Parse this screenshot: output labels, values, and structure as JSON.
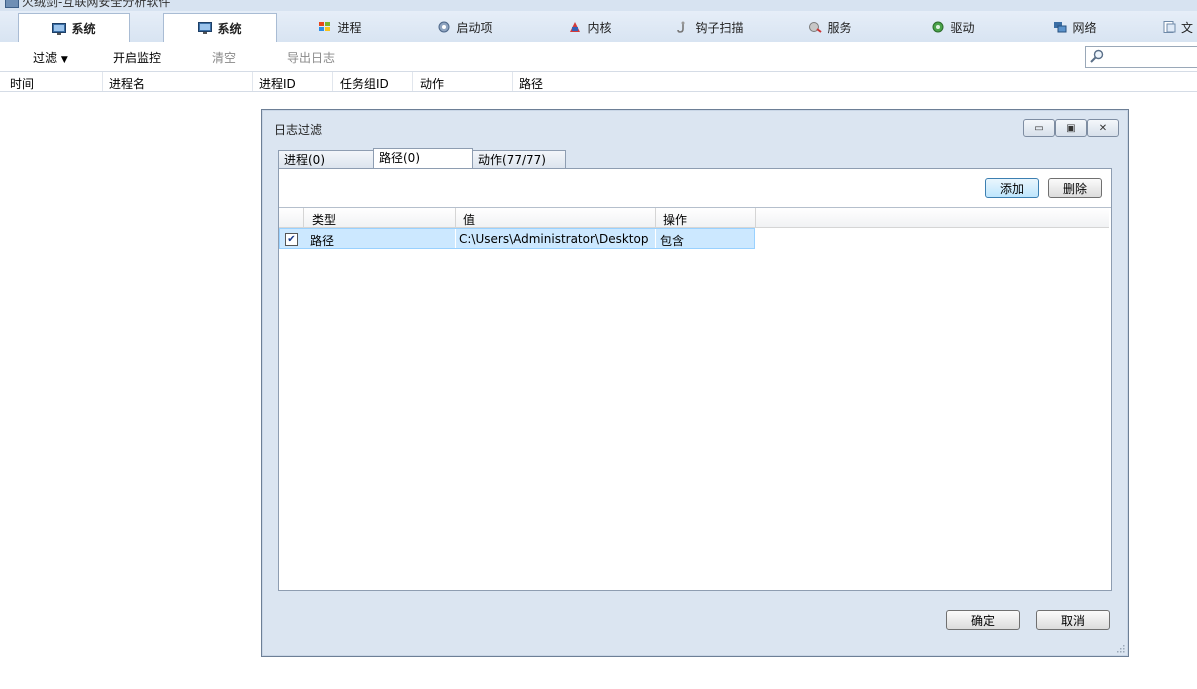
{
  "window": {
    "title": "火绒剑-互联网安全分析软件"
  },
  "tabs": [
    {
      "label": "系统",
      "icon": "monitor-icon"
    },
    {
      "label": "系统",
      "icon": "monitor-icon"
    },
    {
      "label": "进程",
      "icon": "windows-logo-icon"
    },
    {
      "label": "启动项",
      "icon": "startup-gear-icon"
    },
    {
      "label": "内核",
      "icon": "kernel-icon"
    },
    {
      "label": "钩子扫描",
      "icon": "hook-icon"
    },
    {
      "label": "服务",
      "icon": "service-icon"
    },
    {
      "label": "驱动",
      "icon": "driver-icon"
    },
    {
      "label": "网络",
      "icon": "network-icon"
    },
    {
      "label": "文",
      "icon": "file-icon"
    }
  ],
  "toolbar": {
    "filter": "过滤",
    "start_monitor": "开启监控",
    "clear": "清空",
    "export_log": "导出日志",
    "search_placeholder": ""
  },
  "columns": [
    "时间",
    "进程名",
    "进程ID",
    "任务组ID",
    "动作",
    "路径"
  ],
  "dialog": {
    "title": "日志过滤",
    "tabs": [
      "进程(0)",
      "路径(0)",
      "动作(77/77)"
    ],
    "add_button": "添加",
    "delete_button": "删除",
    "grid_headers": [
      "类型",
      "值",
      "操作"
    ],
    "rows": [
      {
        "checked": true,
        "type": "路径",
        "value": "C:\\Users\\Administrator\\Desktop",
        "operation": "包含"
      }
    ],
    "ok_button": "确定",
    "cancel_button": "取消"
  }
}
